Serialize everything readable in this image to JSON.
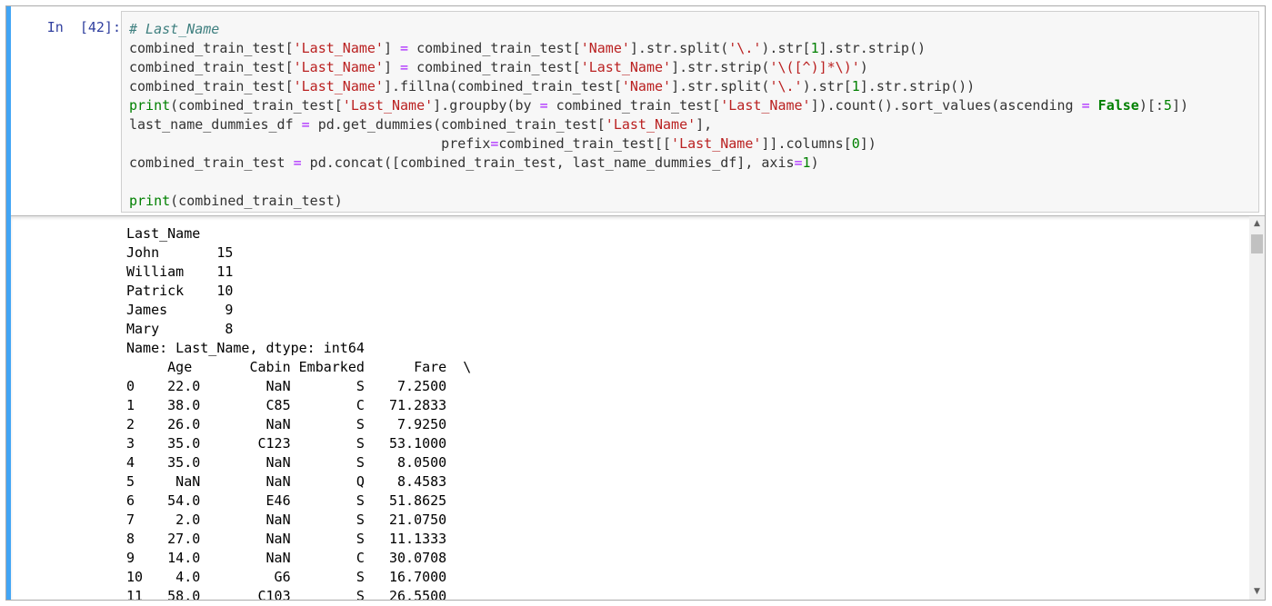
{
  "cell": {
    "prompt": "In  [42]:",
    "code_lines": [
      [
        {
          "t": "# Last_Name",
          "c": "cm"
        }
      ],
      [
        {
          "t": "combined_train_test[",
          "c": ""
        },
        {
          "t": "'Last_Name'",
          "c": "st"
        },
        {
          "t": "] ",
          "c": ""
        },
        {
          "t": "=",
          "c": "op"
        },
        {
          "t": " combined_train_test[",
          "c": ""
        },
        {
          "t": "'Name'",
          "c": "st"
        },
        {
          "t": "].str.split(",
          "c": ""
        },
        {
          "t": "'\\.'",
          "c": "st"
        },
        {
          "t": ").str[",
          "c": ""
        },
        {
          "t": "1",
          "c": "nu"
        },
        {
          "t": "].str.strip()",
          "c": ""
        }
      ],
      [
        {
          "t": "combined_train_test[",
          "c": ""
        },
        {
          "t": "'Last_Name'",
          "c": "st"
        },
        {
          "t": "] ",
          "c": ""
        },
        {
          "t": "=",
          "c": "op"
        },
        {
          "t": " combined_train_test[",
          "c": ""
        },
        {
          "t": "'Last_Name'",
          "c": "st"
        },
        {
          "t": "].str.strip(",
          "c": ""
        },
        {
          "t": "'\\([^)]*\\)'",
          "c": "st"
        },
        {
          "t": ")",
          "c": ""
        }
      ],
      [
        {
          "t": "combined_train_test[",
          "c": ""
        },
        {
          "t": "'Last_Name'",
          "c": "st"
        },
        {
          "t": "].fillna(combined_train_test[",
          "c": ""
        },
        {
          "t": "'Name'",
          "c": "st"
        },
        {
          "t": "].str.split(",
          "c": ""
        },
        {
          "t": "'\\.'",
          "c": "st"
        },
        {
          "t": ").str[",
          "c": ""
        },
        {
          "t": "1",
          "c": "nu"
        },
        {
          "t": "].str.strip())",
          "c": ""
        }
      ],
      [
        {
          "t": "print",
          "c": "nb"
        },
        {
          "t": "(combined_train_test[",
          "c": ""
        },
        {
          "t": "'Last_Name'",
          "c": "st"
        },
        {
          "t": "].groupby(by ",
          "c": ""
        },
        {
          "t": "=",
          "c": "op"
        },
        {
          "t": " combined_train_test[",
          "c": ""
        },
        {
          "t": "'Last_Name'",
          "c": "st"
        },
        {
          "t": "]).count().sort_values(ascending ",
          "c": ""
        },
        {
          "t": "=",
          "c": "op"
        },
        {
          "t": " ",
          "c": ""
        },
        {
          "t": "False",
          "c": "kw"
        },
        {
          "t": ")[:",
          "c": ""
        },
        {
          "t": "5",
          "c": "nu"
        },
        {
          "t": "])",
          "c": ""
        }
      ],
      [
        {
          "t": "last_name_dummies_df ",
          "c": ""
        },
        {
          "t": "=",
          "c": "op"
        },
        {
          "t": " pd.get_dummies(combined_train_test[",
          "c": ""
        },
        {
          "t": "'Last_Name'",
          "c": "st"
        },
        {
          "t": "],",
          "c": ""
        }
      ],
      [
        {
          "t": "                                      prefix",
          "c": ""
        },
        {
          "t": "=",
          "c": "op"
        },
        {
          "t": "combined_train_test[[",
          "c": ""
        },
        {
          "t": "'Last_Name'",
          "c": "st"
        },
        {
          "t": "]].columns[",
          "c": ""
        },
        {
          "t": "0",
          "c": "nu"
        },
        {
          "t": "])",
          "c": ""
        }
      ],
      [
        {
          "t": "combined_train_test ",
          "c": ""
        },
        {
          "t": "=",
          "c": "op"
        },
        {
          "t": " pd.concat([combined_train_test, last_name_dummies_df], axis",
          "c": ""
        },
        {
          "t": "=",
          "c": "op"
        },
        {
          "t": "1",
          "c": "nu"
        },
        {
          "t": ")",
          "c": ""
        }
      ],
      [
        {
          "t": "",
          "c": ""
        }
      ],
      [
        {
          "t": "print",
          "c": "nb"
        },
        {
          "t": "(combined_train_test)",
          "c": ""
        }
      ]
    ],
    "output_lines": [
      "Last_Name",
      "John       15",
      "William    11",
      "Patrick    10",
      "James       9",
      "Mary        8",
      "Name: Last_Name, dtype: int64",
      "     Age       Cabin Embarked      Fare  \\",
      "0    22.0        NaN        S    7.2500",
      "1    38.0        C85        C   71.2833",
      "2    26.0        NaN        S    7.9250",
      "3    35.0       C123        S   53.1000",
      "4    35.0        NaN        S    8.0500",
      "5     NaN        NaN        Q    8.4583",
      "6    54.0        E46        S   51.8625",
      "7     2.0        NaN        S   21.0750",
      "8    27.0        NaN        S   11.1333",
      "9    14.0        NaN        C   30.0708",
      "10    4.0         G6        S   16.7000",
      "11   58.0       C103        S   26.5500"
    ]
  },
  "icons": {
    "scroll_up": "triangle-up-icon",
    "scroll_down": "triangle-down-icon"
  },
  "colors": {
    "selected_bar": "#42a5f5",
    "prompt": "#303f9f",
    "string": "#ba2121",
    "builtin": "#008000",
    "comment": "#408080",
    "operator": "#aa22ff"
  }
}
